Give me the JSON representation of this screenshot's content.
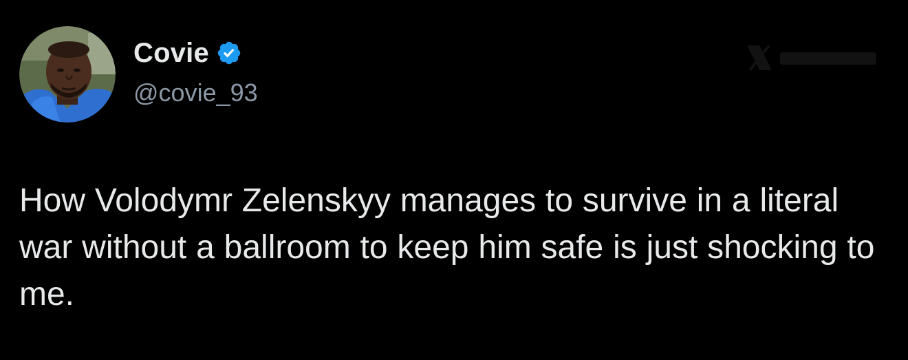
{
  "author": {
    "display_name": "Covie",
    "handle": "@covie_93",
    "verified": true,
    "verified_icon": "verified-badge-icon",
    "verified_color": "#1d9bf0"
  },
  "tweet": {
    "text": "How Volodymr Zelenskyy manages to survive in a literal war without a ballroom to keep him safe is just shocking to me."
  },
  "colors": {
    "background": "#000000",
    "primary_text": "#e7e9ea",
    "secondary_text": "#8b98a5",
    "accent": "#1d9bf0"
  }
}
